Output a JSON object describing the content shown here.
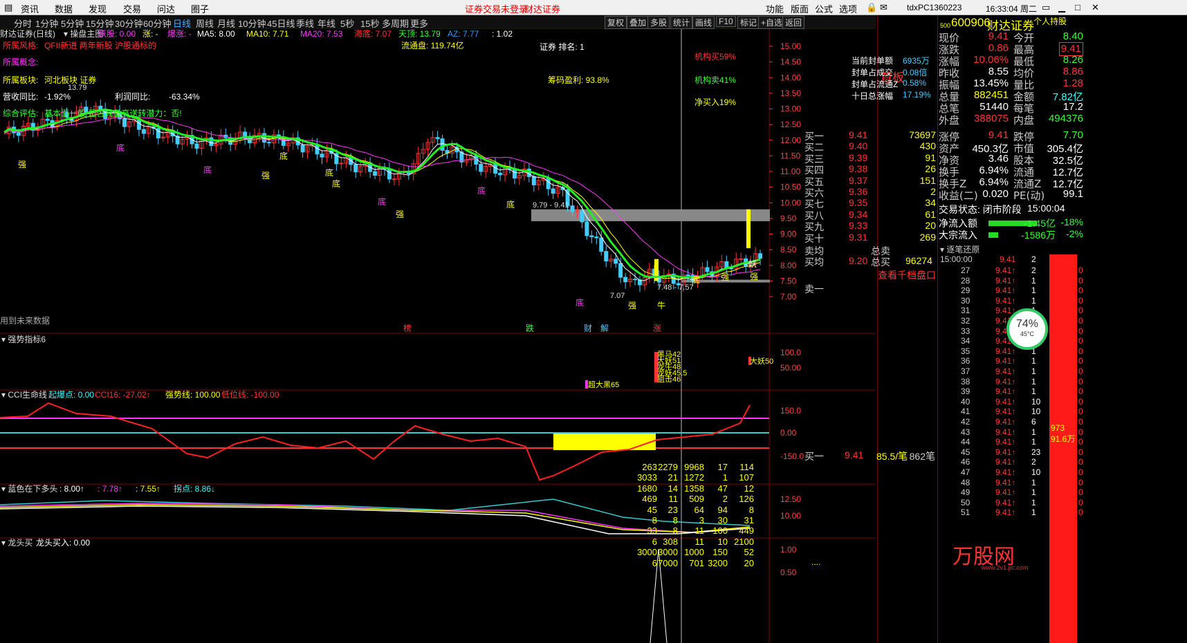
{
  "menubar": {
    "items": [
      "资讯",
      "数据",
      "发现",
      "交易",
      "问达",
      "圈子"
    ],
    "notice": "证券交易未登录",
    "broker": "财达证券",
    "right_items": [
      "功能",
      "版面",
      "公式",
      "选项"
    ],
    "user": "tdxPC1360223",
    "clock": "16:33:04 周二"
  },
  "periods": [
    "分时",
    "1分钟",
    "5分钟",
    "15分钟",
    "30分钟",
    "60分钟",
    "日线",
    "周线",
    "月线",
    "10分钟",
    "45日线",
    "季线",
    "年线",
    "5秒",
    "15秒",
    "多周期",
    "更多"
  ],
  "selected_period": "日线",
  "toolbar": [
    "复权",
    "叠加",
    "多股",
    "统计",
    "画线",
    "F10",
    "标记",
    "+自选",
    "返回"
  ],
  "main": {
    "title": "财达证券(日线)",
    "formula": "操盘主图",
    "legend": [
      {
        "text": "妖股: 0.00",
        "color": "#ff33ff"
      },
      {
        "text": "涨: -",
        "color": "#ffff00"
      },
      {
        "text": "爆涨: -",
        "color": "#ff33ff"
      },
      {
        "text": "MA5: 8.00",
        "color": "#ffffff"
      },
      {
        "text": "MA10: 7.71",
        "color": "#ffff00"
      },
      {
        "text": "MA20: 7.53",
        "color": "#ff33ff"
      },
      {
        "text": "海底: 7.07",
        "color": "#ff3333"
      },
      {
        "text": "天顶: 13.79",
        "color": "#33ff33"
      },
      {
        "text": "AZ: 7.77",
        "color": "#3399ff"
      },
      {
        "text": ": 1.02",
        "color": "#ffffff"
      }
    ],
    "info_lines": [
      {
        "label": "所属风格:",
        "value": "QFII新进 两年新股 沪股通标的",
        "lc": "#ff3333",
        "vc": "#ff3333"
      },
      {
        "label": "所属概念:",
        "value": "",
        "lc": "#ff33ff",
        "vc": "#ff33ff"
      },
      {
        "label": "所属板块:",
        "value": "河北板块   证券",
        "lc": "#ffff00",
        "vc": "#ffff00"
      },
      {
        "label": "营收同比:",
        "value": "-1.92%",
        "lc": "#ffffff",
        "vc": "#ffffff"
      },
      {
        "label": "综合评估:",
        "value": "基本面一般  是否具备高送转潜力：否!",
        "lc": "#33ff33",
        "vc": "#33ff33"
      }
    ],
    "profit_label": "利润同比:",
    "profit_value": "-63.34%",
    "float_cap": "流通盘: 119.74亿",
    "sector_rank": "证券    排名: 1",
    "chip_profit": "筹码盈利: 93.8%",
    "inst_buy": "机构买59%",
    "inst_sell": "机构卖41%",
    "net_buy": "净买入19%",
    "future_note": "用到未来数据",
    "high_label": "13.79",
    "low_label": "7.07",
    "range1": "9.79 - 9.41",
    "range2": "7.48 - 7.57",
    "event_labels": [
      "榜",
      "跌",
      "财",
      "解",
      "涨"
    ],
    "price_ticks": [
      "15.00",
      "14.50",
      "14.00",
      "13.50",
      "13.00",
      "12.50",
      "12.00",
      "11.50",
      "11.00",
      "10.50",
      "10.00",
      "9.50",
      "9.00",
      "8.50",
      "8.00",
      "7.50",
      "7.00"
    ],
    "tags": {
      "qiang": "强",
      "di": "底",
      "yao": "妖",
      "niu": "牛"
    }
  },
  "ind1": {
    "title": "强势指标6",
    "ticks": [
      "100.0",
      "50.00"
    ],
    "labels": [
      "黑马42",
      "大妖51",
      "龙牛48",
      "龙妖45.5",
      "狙击46"
    ],
    "label_right": "大妖50",
    "label_bottom": "超大黑65"
  },
  "ind2": {
    "title": "CCI生命线",
    "legend": [
      {
        "text": "起爆点: 0.00",
        "color": "#33ffff"
      },
      {
        "text": "CCI16: -27.02↑",
        "color": "#ff3333"
      },
      {
        "text": "强势线: 100.00",
        "color": "#ffff00"
      },
      {
        "text": "低位线: -100.00",
        "color": "#ff3333"
      }
    ],
    "ticks": [
      "150.0",
      "0.00",
      "-150.0"
    ]
  },
  "ind3": {
    "title": "蓝色在下多头",
    "legend": [
      {
        "text": ": 8.00↑",
        "color": "#ffffff"
      },
      {
        "text": ": 7.78↑",
        "color": "#ff33ff"
      },
      {
        "text": ": 7.55↑",
        "color": "#ffff00"
      },
      {
        "text": "拐点: 8.86↓",
        "color": "#33ffff"
      }
    ],
    "ticks": [
      "12.50",
      "10.00"
    ]
  },
  "ind4": {
    "title": "龙头买",
    "legend": [
      {
        "text": "龙头买入: 0.00",
        "color": "#ffffff"
      }
    ],
    "ticks": [
      "1.00",
      "0.50"
    ]
  },
  "quote": {
    "code": "600906",
    "name": "财达证券",
    "personal": "个人持股",
    "top_small": "500",
    "left_cells": [
      {
        "l": "现价",
        "v": "9.41",
        "c": "#ff3333"
      },
      {
        "l": "涨跌",
        "v": "0.86",
        "c": "#ff3333"
      },
      {
        "l": "涨幅",
        "v": "10.06%",
        "c": "#ff3333"
      },
      {
        "l": "昨收",
        "v": "8.55",
        "c": "#ffffff"
      },
      {
        "l": "振幅",
        "v": "13.45%",
        "c": "#ffffff"
      },
      {
        "l": "总量",
        "v": "882451",
        "c": "#ffff00"
      },
      {
        "l": "总笔",
        "v": "51440",
        "c": "#ffffff"
      },
      {
        "l": "外盘",
        "v": "388075",
        "c": "#ff3333"
      }
    ],
    "right_cells": [
      {
        "l": "今开",
        "v": "8.40",
        "c": "#33ff33"
      },
      {
        "l": "最高",
        "v": "9.41",
        "c": "#ff3333",
        "boxed": true
      },
      {
        "l": "最低",
        "v": "8.26",
        "c": "#33ff33"
      },
      {
        "l": "均价",
        "v": "8.86",
        "c": "#ff3333"
      },
      {
        "l": "量比",
        "v": "1.28",
        "c": "#ff3333"
      },
      {
        "l": "金额",
        "v": "7.82亿",
        "c": "#33ffff"
      },
      {
        "l": "每笔",
        "v": "17.2",
        "c": "#ffffff"
      },
      {
        "l": "内盘",
        "v": "494376",
        "c": "#33ff33"
      }
    ],
    "seal_title": "首板",
    "seal_lines": [
      {
        "l": "当前封单额",
        "v": "6935万"
      },
      {
        "l": "封单占成交",
        "v": "0.08倍"
      },
      {
        "l": "封单占流通Z",
        "v": "0.58%"
      },
      {
        "l": "十日总涨幅",
        "v": "17.19%"
      }
    ],
    "bids": [
      {
        "l": "买一",
        "p": "9.41",
        "v": "73697"
      },
      {
        "l": "买二",
        "p": "9.40",
        "v": "430"
      },
      {
        "l": "买三",
        "p": "9.39",
        "v": "91"
      },
      {
        "l": "买四",
        "p": "9.38",
        "v": "26"
      },
      {
        "l": "买五",
        "p": "9.37",
        "v": "151"
      },
      {
        "l": "买六",
        "p": "9.36",
        "v": "2"
      },
      {
        "l": "买七",
        "p": "9.35",
        "v": "34"
      },
      {
        "l": "买八",
        "p": "9.34",
        "v": "61"
      },
      {
        "l": "买九",
        "p": "9.33",
        "v": "20"
      },
      {
        "l": "买十",
        "p": "9.31",
        "v": "269"
      }
    ],
    "avg_sell_label": "卖均",
    "avg_buy_label": "买均",
    "avg_buy_price": "9.20",
    "total_sell_label": "总卖",
    "total_buy_label": "总买",
    "total_buy": "96274",
    "depth_link": "查看千档盘口",
    "sell1_label": "卖一",
    "stats": [
      {
        "l": "涨停",
        "v": "9.41",
        "c": "#ff3333",
        "l2": "跌停",
        "v2": "7.70",
        "c2": "#33ff33"
      },
      {
        "l": "资产",
        "v": "450.3亿",
        "c": "#ffffff",
        "l2": "市值",
        "v2": "305.4亿",
        "c2": "#ffffff"
      },
      {
        "l": "净资",
        "v": "3.46",
        "c": "#ffffff",
        "l2": "股本",
        "v2": "32.5亿",
        "c2": "#ffffff"
      },
      {
        "l": "换手",
        "v": "6.94%",
        "c": "#ffffff",
        "l2": "流通",
        "v2": "12.7亿",
        "c2": "#ffffff"
      },
      {
        "l": "换手Z",
        "v": "6.94%",
        "c": "#ffffff",
        "l2": "流通Z",
        "v2": "12.7亿",
        "c2": "#ffffff"
      },
      {
        "l": "收益(二)",
        "v": "0.020",
        "c": "#ffffff",
        "l2": "PE(动)",
        "v2": "99.1",
        "c2": "#ffffff"
      }
    ],
    "trade_state": "交易状态: 闭市阶段",
    "trade_time": "15:00:04",
    "net_inflow_label": "净流入额",
    "net_inflow": "-1.45亿",
    "net_inflow_pct": "-18%",
    "big_inflow_label": "大宗流入",
    "big_inflow": "-1586万",
    "big_inflow_pct": "-2%",
    "bid1_queue_label": "买一",
    "bid1_queue_price": "9.41",
    "bid1_queue_avg": "85.5/笔",
    "bid1_queue_count": "862笔",
    "queue_rows": [
      [
        "263",
        "2279",
        "9968",
        "17",
        "114"
      ],
      [
        "3033",
        "21",
        "1272",
        "1",
        "107"
      ],
      [
        "1680",
        "14",
        "1358",
        "47",
        "12"
      ],
      [
        "469",
        "11",
        "509",
        "2",
        "126"
      ],
      [
        "45",
        "23",
        "64",
        "94",
        "8"
      ],
      [
        "8",
        "8",
        "3",
        "30",
        "31"
      ],
      [
        "33",
        "8",
        "11",
        "100",
        "449"
      ],
      [
        "6",
        "308",
        "11",
        "10",
        "2100"
      ],
      [
        "3000",
        "3000",
        "1000",
        "150",
        "52"
      ],
      [
        "6",
        "7000",
        "701",
        "3200",
        "20"
      ]
    ],
    "queue_more": "....",
    "tick_title": "逐笔还原",
    "tick_first_time": "15:00:00",
    "tick_minutes": [
      "27",
      "28",
      "29",
      "30",
      "31",
      "32",
      "33",
      "34",
      "35",
      "36",
      "37",
      "38",
      "39",
      "40",
      "41",
      "42",
      "43",
      "44",
      "45",
      "46",
      "47",
      "48",
      "49",
      "50",
      "51"
    ],
    "tick_price": "9.41",
    "tick_vols": [
      "2",
      "1",
      "1",
      "1",
      "1",
      "1",
      "1",
      "1",
      "1",
      "1",
      "1",
      "1",
      "1",
      "10",
      "10",
      "6",
      "1",
      "1",
      "23",
      "2",
      "10",
      "1",
      "1",
      "1",
      "1"
    ],
    "bar_vol": "973",
    "bar_amount": "91.6万",
    "gauge_pct": "74%",
    "gauge_temp": "45°C",
    "watermark": "万股网",
    "watermark_url": "www.2v1.pc.com"
  }
}
